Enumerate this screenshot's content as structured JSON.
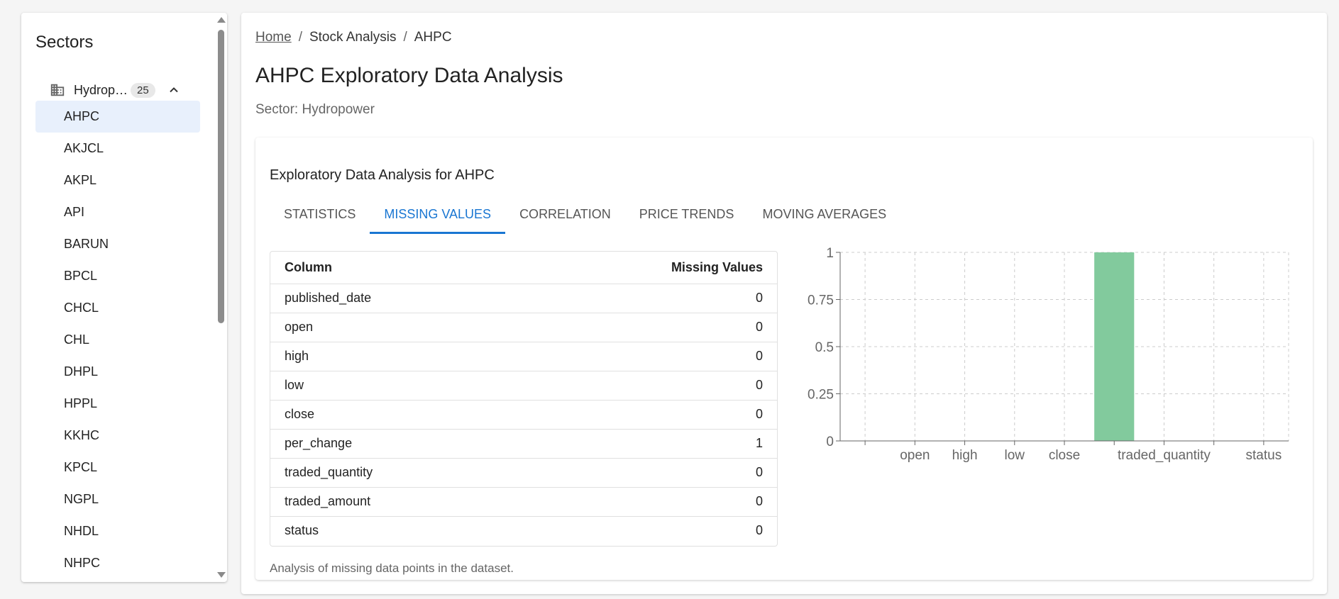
{
  "sidebar": {
    "title": "Sectors",
    "sector": {
      "name": "Hydrop…",
      "count": "25",
      "icon": "building-icon",
      "toggle_icon": "chevron-up-icon"
    },
    "companies": [
      "AHPC",
      "AKJCL",
      "AKPL",
      "API",
      "BARUN",
      "BPCL",
      "CHCL",
      "CHL",
      "DHPL",
      "HPPL",
      "KKHC",
      "KPCL",
      "NGPL",
      "NHDL",
      "NHPC"
    ],
    "selected": "AHPC"
  },
  "breadcrumb": {
    "home": "Home",
    "section": "Stock Analysis",
    "current": "AHPC",
    "separator": "/"
  },
  "page": {
    "title": "AHPC Exploratory Data Analysis",
    "sector_line": "Sector: Hydropower"
  },
  "card": {
    "title": "Exploratory Data Analysis for AHPC",
    "tabs": [
      "STATISTICS",
      "MISSING VALUES",
      "CORRELATION",
      "PRICE TRENDS",
      "MOVING AVERAGES"
    ],
    "active_tab": "MISSING VALUES",
    "footnote": "Analysis of missing data points in the dataset."
  },
  "table": {
    "headers": [
      "Column",
      "Missing Values"
    ],
    "rows": [
      [
        "published_date",
        "0"
      ],
      [
        "open",
        "0"
      ],
      [
        "high",
        "0"
      ],
      [
        "low",
        "0"
      ],
      [
        "close",
        "0"
      ],
      [
        "per_change",
        "1"
      ],
      [
        "traded_quantity",
        "0"
      ],
      [
        "traded_amount",
        "0"
      ],
      [
        "status",
        "0"
      ]
    ]
  },
  "colors": {
    "accent": "#1976d2",
    "bar": "#82ca9d",
    "selected_bg": "#e8f0fc"
  },
  "chart_data": {
    "type": "bar",
    "categories": [
      "published_date",
      "open",
      "high",
      "low",
      "close",
      "per_change",
      "traded_quantity",
      "traded_amount",
      "status"
    ],
    "visible_tick_labels": [
      "open",
      "high",
      "low",
      "close",
      "traded_quantity",
      "status"
    ],
    "values": [
      0,
      0,
      0,
      0,
      0,
      1,
      0,
      0,
      0
    ],
    "ylim": [
      0,
      1
    ],
    "yticks": [
      "0",
      "0.25",
      "0.5",
      "0.75",
      "1"
    ],
    "grid": true,
    "xlabel": "",
    "ylabel": "",
    "title": ""
  }
}
